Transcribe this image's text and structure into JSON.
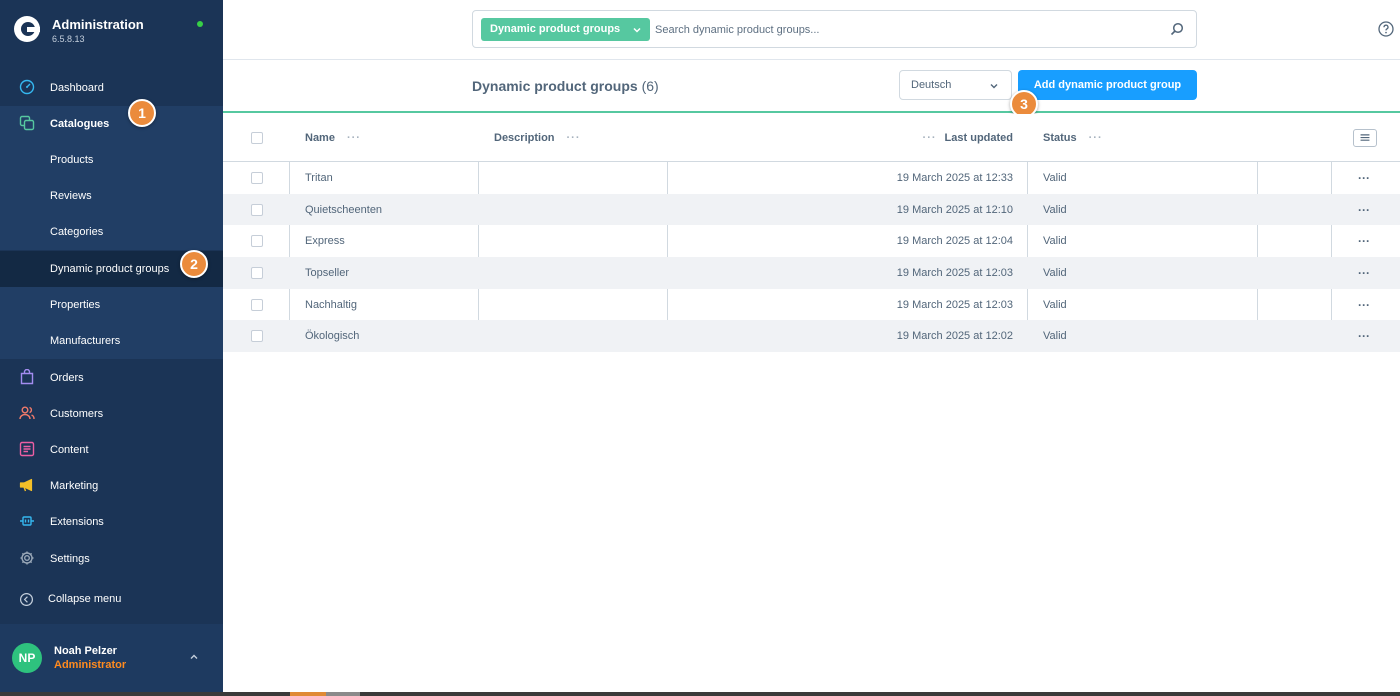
{
  "brand": {
    "title": "Administration",
    "version": "6.5.8.13"
  },
  "nav": {
    "dashboard": "Dashboard",
    "catalogues": "Catalogues",
    "products": "Products",
    "reviews": "Reviews",
    "categories": "Categories",
    "dynamic_product_groups": "Dynamic product groups",
    "properties": "Properties",
    "manufacturers": "Manufacturers",
    "orders": "Orders",
    "customers": "Customers",
    "content": "Content",
    "marketing": "Marketing",
    "extensions": "Extensions",
    "settings": "Settings",
    "collapse": "Collapse menu"
  },
  "user": {
    "initials": "NP",
    "name": "Noah Pelzer",
    "role": "Administrator"
  },
  "badges": [
    "1",
    "2",
    "3"
  ],
  "search": {
    "type_label": "Dynamic product groups",
    "placeholder": "Search dynamic product groups..."
  },
  "header": {
    "title": "Dynamic product groups",
    "count": "(6)",
    "language": "Deutsch",
    "add_button": "Add dynamic product group"
  },
  "table": {
    "columns": {
      "name": "Name",
      "description": "Description",
      "last_updated": "Last updated",
      "status": "Status"
    },
    "rows": [
      {
        "name": "Tritan",
        "description": "",
        "last_updated": "19 March 2025 at 12:33",
        "status": "Valid"
      },
      {
        "name": "Quietscheenten",
        "description": "",
        "last_updated": "19 March 2025 at 12:10",
        "status": "Valid"
      },
      {
        "name": "Express",
        "description": "",
        "last_updated": "19 March 2025 at 12:04",
        "status": "Valid"
      },
      {
        "name": "Topseller",
        "description": "",
        "last_updated": "19 March 2025 at 12:03",
        "status": "Valid"
      },
      {
        "name": "Nachhaltig",
        "description": "",
        "last_updated": "19 March 2025 at 12:03",
        "status": "Valid"
      },
      {
        "name": "Ökologisch",
        "description": "",
        "last_updated": "19 March 2025 at 12:02",
        "status": "Valid"
      }
    ]
  },
  "colors": {
    "sidebar": "#1b3456",
    "accent_green": "#56c8a0",
    "primary_blue": "#189eff",
    "badge_orange": "#eb8b3c"
  },
  "icons": {
    "dashboard": "dashboard-gauge-icon",
    "catalogues": "catalogue-squares-icon",
    "orders": "shopping-bag-icon",
    "customers": "users-icon",
    "content": "content-list-icon",
    "marketing": "megaphone-icon",
    "extensions": "plug-icon",
    "settings": "gear-icon"
  }
}
